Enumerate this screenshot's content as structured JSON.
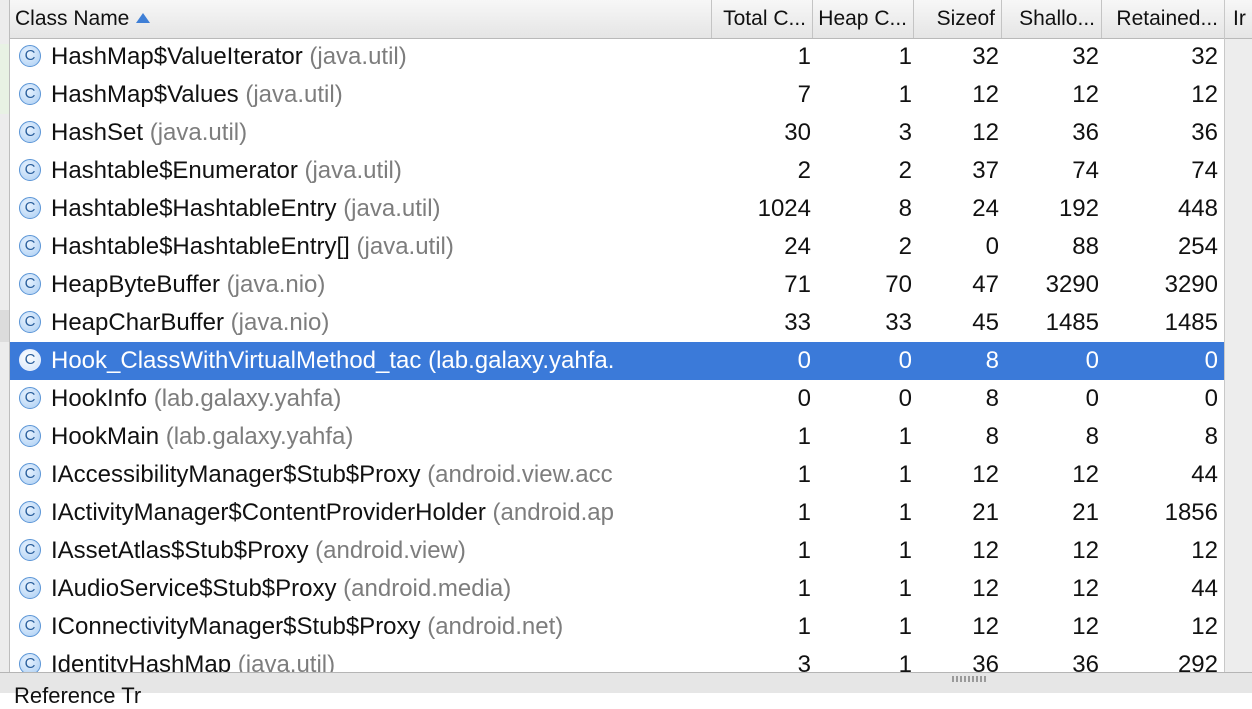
{
  "columns": {
    "class_name": "Class Name",
    "total_count": "Total C...",
    "heap_count": "Heap C...",
    "sizeof": "Sizeof",
    "shallow": "Shallo...",
    "retained": "Retained...",
    "right_panel": "Ir"
  },
  "rows": [
    {
      "name": "HashMap$ValueIterator",
      "pkg": "(java.util)",
      "total": "1",
      "heap": "1",
      "sizeof": "32",
      "shallow": "32",
      "retained": "32"
    },
    {
      "name": "HashMap$Values",
      "pkg": "(java.util)",
      "total": "7",
      "heap": "1",
      "sizeof": "12",
      "shallow": "12",
      "retained": "12"
    },
    {
      "name": "HashSet",
      "pkg": "(java.util)",
      "total": "30",
      "heap": "3",
      "sizeof": "12",
      "shallow": "36",
      "retained": "36"
    },
    {
      "name": "Hashtable$Enumerator",
      "pkg": "(java.util)",
      "total": "2",
      "heap": "2",
      "sizeof": "37",
      "shallow": "74",
      "retained": "74"
    },
    {
      "name": "Hashtable$HashtableEntry",
      "pkg": "(java.util)",
      "total": "1024",
      "heap": "8",
      "sizeof": "24",
      "shallow": "192",
      "retained": "448"
    },
    {
      "name": "Hashtable$HashtableEntry[]",
      "pkg": "(java.util)",
      "total": "24",
      "heap": "2",
      "sizeof": "0",
      "shallow": "88",
      "retained": "254"
    },
    {
      "name": "HeapByteBuffer",
      "pkg": "(java.nio)",
      "total": "71",
      "heap": "70",
      "sizeof": "47",
      "shallow": "3290",
      "retained": "3290"
    },
    {
      "name": "HeapCharBuffer",
      "pkg": "(java.nio)",
      "total": "33",
      "heap": "33",
      "sizeof": "45",
      "shallow": "1485",
      "retained": "1485"
    },
    {
      "name": "Hook_ClassWithVirtualMethod_tac",
      "pkg": "(lab.galaxy.yahfa.",
      "total": "0",
      "heap": "0",
      "sizeof": "8",
      "shallow": "0",
      "retained": "0",
      "selected": true
    },
    {
      "name": "HookInfo",
      "pkg": "(lab.galaxy.yahfa)",
      "total": "0",
      "heap": "0",
      "sizeof": "8",
      "shallow": "0",
      "retained": "0"
    },
    {
      "name": "HookMain",
      "pkg": "(lab.galaxy.yahfa)",
      "total": "1",
      "heap": "1",
      "sizeof": "8",
      "shallow": "8",
      "retained": "8"
    },
    {
      "name": "IAccessibilityManager$Stub$Proxy",
      "pkg": "(android.view.acc",
      "total": "1",
      "heap": "1",
      "sizeof": "12",
      "shallow": "12",
      "retained": "44"
    },
    {
      "name": "IActivityManager$ContentProviderHolder",
      "pkg": "(android.ap",
      "total": "1",
      "heap": "1",
      "sizeof": "21",
      "shallow": "21",
      "retained": "1856"
    },
    {
      "name": "IAssetAtlas$Stub$Proxy",
      "pkg": "(android.view)",
      "total": "1",
      "heap": "1",
      "sizeof": "12",
      "shallow": "12",
      "retained": "12"
    },
    {
      "name": "IAudioService$Stub$Proxy",
      "pkg": "(android.media)",
      "total": "1",
      "heap": "1",
      "sizeof": "12",
      "shallow": "12",
      "retained": "44"
    },
    {
      "name": "IConnectivityManager$Stub$Proxy",
      "pkg": "(android.net)",
      "total": "1",
      "heap": "1",
      "sizeof": "12",
      "shallow": "12",
      "retained": "12"
    },
    {
      "name": "IdentityHashMap",
      "pkg": "(java.util)",
      "total": "3",
      "heap": "1",
      "sizeof": "36",
      "shallow": "36",
      "retained": "292"
    }
  ],
  "icon": {
    "glyph": "C",
    "name": "class-icon"
  },
  "bottom": {
    "label": "Reference Tr"
  },
  "colors": {
    "selection": "#3b7ad9",
    "package_text": "#7d7d7d",
    "sort_arrow": "#3f7fd6"
  }
}
